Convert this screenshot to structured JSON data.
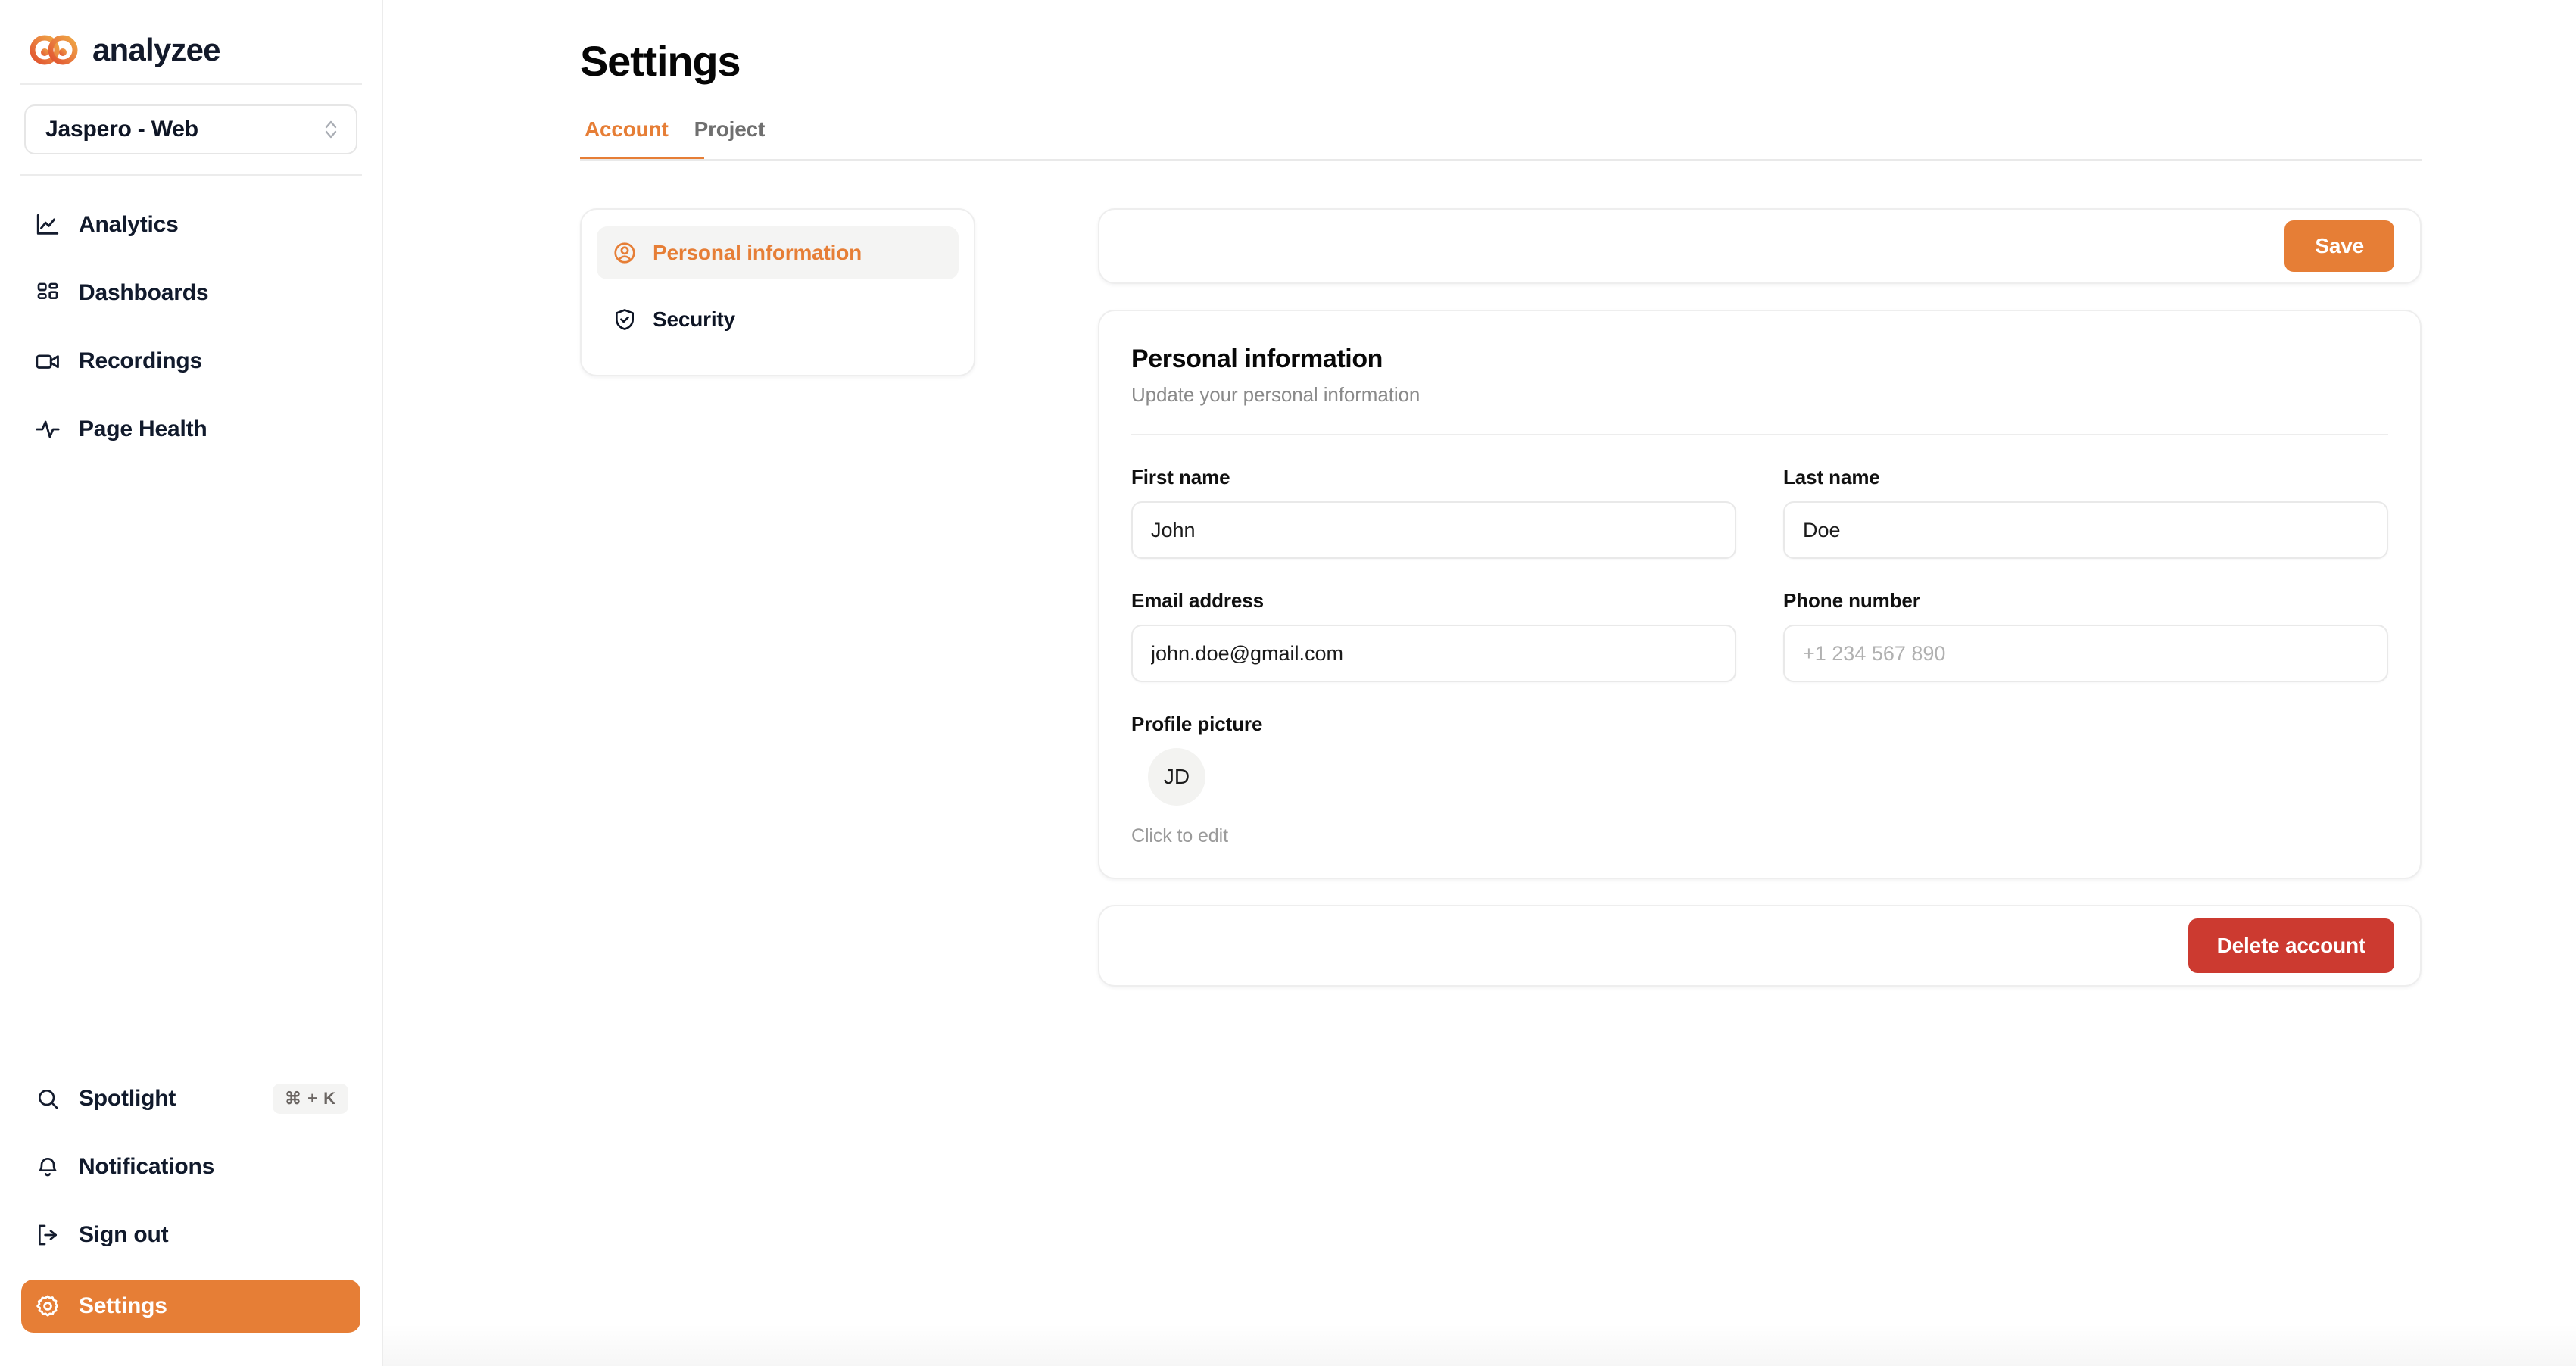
{
  "brand": {
    "name": "analyzee",
    "logo_icon": "infinity-loop-logo",
    "accent": "#e67e36"
  },
  "sidebar": {
    "project_switcher": {
      "value": "Jaspero - Web",
      "icon": "chevron-up-down-icon"
    },
    "main_items": [
      {
        "label": "Analytics",
        "icon": "line-chart-icon"
      },
      {
        "label": "Dashboards",
        "icon": "grid-squares-icon"
      },
      {
        "label": "Recordings",
        "icon": "video-camera-icon"
      },
      {
        "label": "Page Health",
        "icon": "activity-pulse-icon"
      }
    ],
    "bottom_items": [
      {
        "label": "Spotlight",
        "icon": "search-icon",
        "shortcut": "⌘ + K",
        "active": false
      },
      {
        "label": "Notifications",
        "icon": "bell-icon",
        "shortcut": "",
        "active": false
      },
      {
        "label": "Sign out",
        "icon": "sign-out-icon",
        "shortcut": "",
        "active": false
      },
      {
        "label": "Settings",
        "icon": "gear-icon",
        "shortcut": "",
        "active": true
      }
    ]
  },
  "page": {
    "title": "Settings",
    "tabs": [
      {
        "label": "Account",
        "active": true
      },
      {
        "label": "Project",
        "active": false
      }
    ]
  },
  "subnav": {
    "items": [
      {
        "label": "Personal information",
        "icon": "user-circle-icon",
        "active": true
      },
      {
        "label": "Security",
        "icon": "shield-check-icon",
        "active": false
      }
    ]
  },
  "toolbar": {
    "save_label": "Save"
  },
  "personal_information": {
    "title": "Personal information",
    "subtitle": "Update your personal information",
    "fields": {
      "first_name": {
        "label": "First name",
        "value": "John",
        "placeholder": ""
      },
      "last_name": {
        "label": "Last name",
        "value": "Doe",
        "placeholder": ""
      },
      "email": {
        "label": "Email address",
        "value": "john.doe@gmail.com",
        "placeholder": ""
      },
      "phone": {
        "label": "Phone number",
        "value": "",
        "placeholder": "+1 234 567 890"
      }
    },
    "profile_picture": {
      "label": "Profile picture",
      "initials": "JD",
      "hint": "Click to edit"
    }
  },
  "danger_zone": {
    "delete_label": "Delete account",
    "color": "#cc3a30"
  }
}
